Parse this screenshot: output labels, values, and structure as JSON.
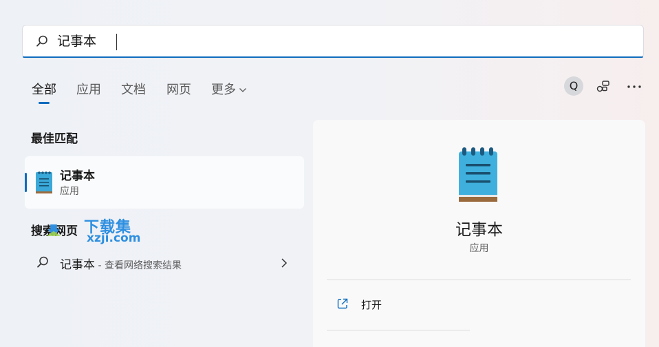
{
  "search": {
    "query": "记事本"
  },
  "tabs": [
    {
      "label": "全部",
      "active": true
    },
    {
      "label": "应用"
    },
    {
      "label": "文档"
    },
    {
      "label": "网页"
    },
    {
      "label": "更多"
    }
  ],
  "top_right": {
    "avatar_letter": "Q"
  },
  "best_match": {
    "title": "最佳匹配",
    "app_name": "记事本",
    "app_type": "应用"
  },
  "web_search": {
    "title": "搜索网页",
    "query": "记事本",
    "suffix": " - 查看网络搜索结果"
  },
  "watermark": {
    "text_cn": "下载集",
    "text_en": "xzji.com"
  },
  "detail": {
    "app_name": "记事本",
    "app_type": "应用",
    "open_label": "打开"
  },
  "colors": {
    "accent": "#0f6cbd",
    "watermark": "#2e8fe0"
  }
}
